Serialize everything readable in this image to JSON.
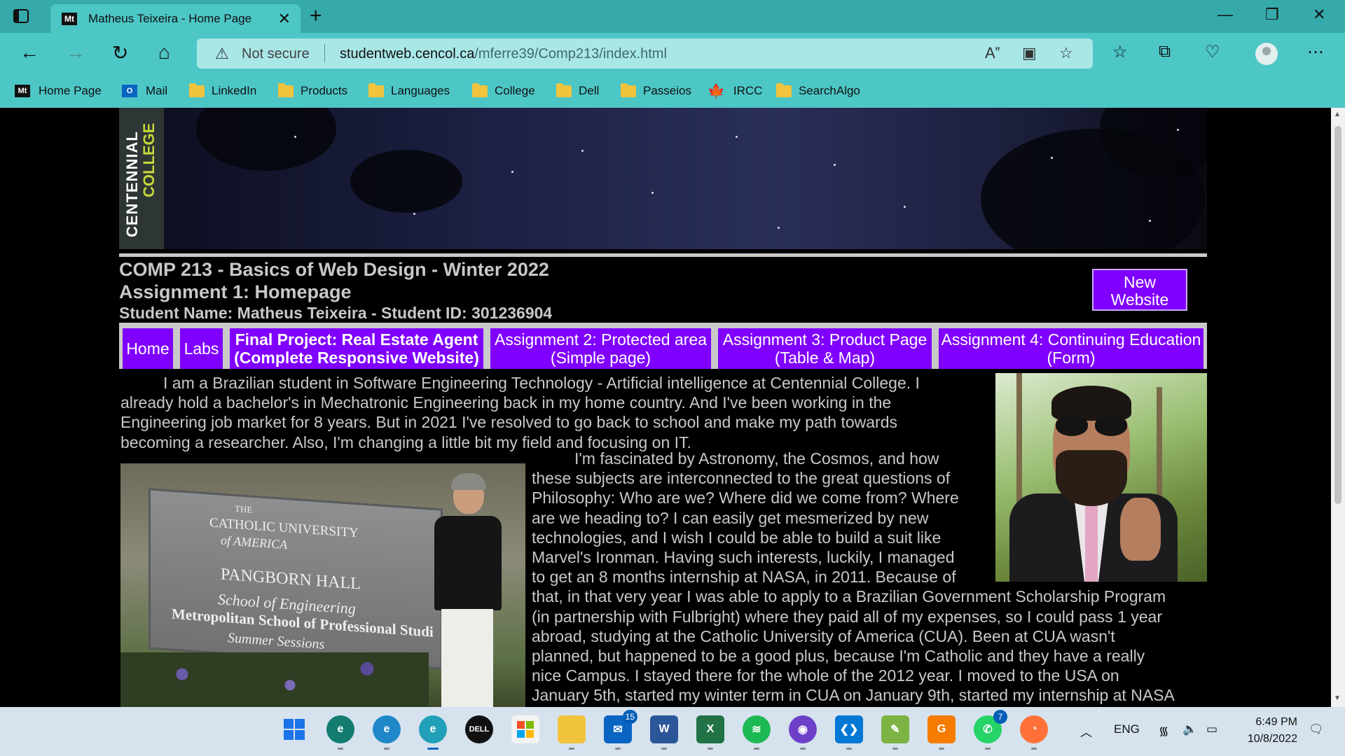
{
  "browser": {
    "tab_title": "Matheus Teixeira - Home Page",
    "tab_favicon": "Mt",
    "address_security": "Not secure",
    "address_host": "studentweb.cencol.ca",
    "address_path": "/mferre39/Comp213/index.html",
    "new_tab_glyph": "+",
    "icons": [
      "tab-actions-icon",
      "close-icon",
      "minimize-icon",
      "maximize-icon",
      "back-icon",
      "forward-icon",
      "refresh-icon",
      "home-icon",
      "warning-icon",
      "read-aloud-icon",
      "immersive-reader-icon",
      "add-favorite-icon",
      "favorites-icon",
      "collections-icon",
      "performance-icon",
      "profile-avatar",
      "more-icon"
    ]
  },
  "favorites": [
    {
      "label": "Home Page",
      "icon": "Mt"
    },
    {
      "label": "Mail",
      "icon": "O"
    },
    {
      "label": "LinkedIn",
      "icon": "folder"
    },
    {
      "label": "Products",
      "icon": "folder"
    },
    {
      "label": "Languages",
      "icon": "folder"
    },
    {
      "label": "College",
      "icon": "folder"
    },
    {
      "label": "Dell",
      "icon": "folder"
    },
    {
      "label": "Passeios",
      "icon": "folder"
    },
    {
      "label": "IRCC",
      "icon": "maple-leaf"
    },
    {
      "label": "SearchAlgo",
      "icon": "folder"
    }
  ],
  "page": {
    "logo_line1": "CENTENNIAL",
    "logo_line2": "COLLEGE",
    "course_title": "COMP 213 - Basics of Web Design - Winter 2022",
    "assignment_title": "Assignment 1: Homepage",
    "student_line": "Student Name: Matheus Teixeira - Student ID: 301236904",
    "new_website_button": "New Website",
    "nav": [
      {
        "label": "Home"
      },
      {
        "label": "Labs"
      },
      {
        "label": "Final Project: Real Estate Agent (Complete Responsive Website)"
      },
      {
        "label": "Assignment 2: Protected area (Simple page)"
      },
      {
        "label": "Assignment 3: Product Page (Table & Map)"
      },
      {
        "label": "Assignment 4: Continuing Education (Form)"
      }
    ],
    "para1": "I am a Brazilian student in Software Engineering Technology - Artificial intelligence at Centennial College. I already hold a bachelor's in Mechatronic Engineering back in my home country. And I've been working in the Engineering job market for 8 years. But in 2021 I've resolved to go back to school and make my path towards becoming a researcher. Also, I'm changing a little bit my field and focusing on IT.",
    "para2_lines": [
      "I'm fascinated by Astronomy, the Cosmos, and how",
      "these subjects are interconnected to the great questions of",
      "Philosophy: Who are we? Where did we come from? Where",
      "are we heading to? I can easily get mesmerized by new",
      "technologies, and I wish I could be able to build a suit like",
      "Marvel's Ironman. Having such interests, luckily, I managed",
      "to get an 8 months internship at NASA, in 2011. Because of",
      "that, in that very year I was able to apply to a Brazilian Government Scholarship Program",
      "(in partnership with Fulbright) where they paid all of my expenses, so I could pass 1 year",
      "abroad, studying at the Catholic University of America (CUA). Been at CUA wasn't",
      "planned, but happened to be a good plus, because I'm Catholic and they have a really",
      "nice Campus. I stayed there for the whole of the 2012 year. I moved to the USA on",
      "January 5th, started my winter term in CUA on January 9th, started my internship at NASA"
    ],
    "sign": {
      "the": "THE",
      "cua1": "CATHOLIC UNIVERSITY",
      "cua2": "of AMERICA",
      "hall": "PANGBORN HALL",
      "school": "School of Engineering",
      "metro": "Metropolitan School of Professional Studi",
      "summer": "Summer Sessions"
    }
  },
  "taskbar": {
    "apps": [
      {
        "name": "start-icon",
        "badge": ""
      },
      {
        "name": "edge-profile-1-icon",
        "badge": ""
      },
      {
        "name": "edge-profile-2-icon",
        "badge": ""
      },
      {
        "name": "edge-active-icon",
        "badge": ""
      },
      {
        "name": "dell-icon",
        "badge": ""
      },
      {
        "name": "store-icon",
        "badge": ""
      },
      {
        "name": "file-explorer-icon",
        "badge": ""
      },
      {
        "name": "mail-icon",
        "badge": "15"
      },
      {
        "name": "word-icon",
        "badge": ""
      },
      {
        "name": "excel-icon",
        "badge": ""
      },
      {
        "name": "spotify-icon",
        "badge": ""
      },
      {
        "name": "github-icon",
        "badge": ""
      },
      {
        "name": "vscode-icon",
        "badge": ""
      },
      {
        "name": "notepad-icon",
        "badge": ""
      },
      {
        "name": "pdf-icon",
        "badge": ""
      },
      {
        "name": "whatsapp-icon",
        "badge": "7"
      },
      {
        "name": "firefox-icon",
        "badge": ""
      }
    ],
    "language": "ENG",
    "time": "6:49 PM",
    "date": "10/8/2022"
  }
}
